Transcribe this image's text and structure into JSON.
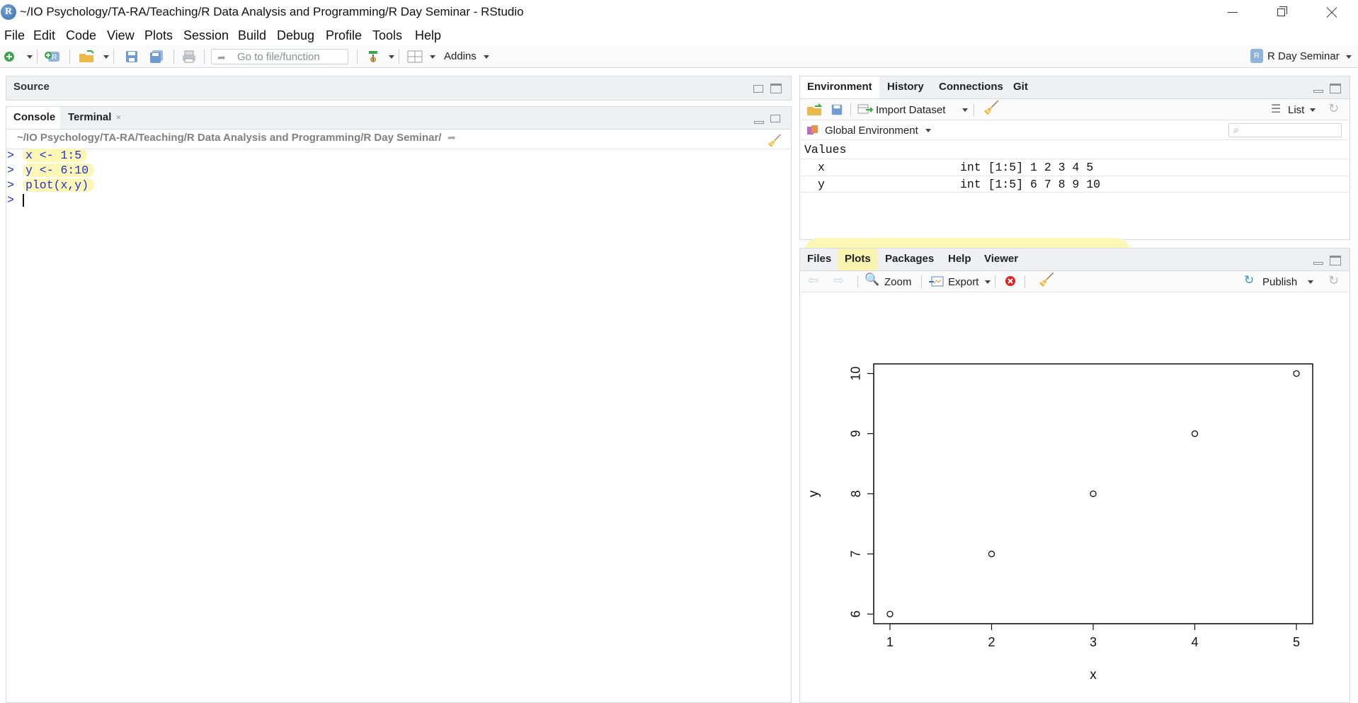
{
  "window": {
    "title": "~/IO Psychology/TA-RA/Teaching/R Data Analysis and Programming/R Day Seminar - RStudio",
    "logo_letter": "R"
  },
  "menu": [
    "File",
    "Edit",
    "Code",
    "View",
    "Plots",
    "Session",
    "Build",
    "Debug",
    "Profile",
    "Tools",
    "Help"
  ],
  "toolbar": {
    "goto_placeholder": "Go to file/function",
    "addins_label": "Addins",
    "project_label": "R Day Seminar"
  },
  "source": {
    "title": "Source"
  },
  "console": {
    "tabs": [
      "Console",
      "Terminal"
    ],
    "path": "~/IO Psychology/TA-RA/Teaching/R Data Analysis and Programming/R Day Seminar/",
    "prompt": ">",
    "lines": [
      "x <- 1:5",
      "y <- 6:10",
      "plot(x,y)"
    ]
  },
  "environment": {
    "tabs": [
      "Environment",
      "History",
      "Connections",
      "Git"
    ],
    "import_label": "Import Dataset",
    "view_mode": "List",
    "scope": "Global Environment",
    "section": "Values",
    "rows": [
      {
        "name": "x",
        "value": "int [1:5] 1 2 3 4 5"
      },
      {
        "name": "y",
        "value": "int [1:5] 6 7 8 9 10"
      }
    ]
  },
  "plots_pane": {
    "tabs": [
      "Files",
      "Plots",
      "Packages",
      "Help",
      "Viewer"
    ],
    "zoom_label": "Zoom",
    "export_label": "Export",
    "publish_label": "Publish"
  },
  "chart_data": {
    "type": "scatter",
    "x": [
      1,
      2,
      3,
      4,
      5
    ],
    "y": [
      6,
      7,
      8,
      9,
      10
    ],
    "xlabel": "x",
    "ylabel": "y",
    "xlim": [
      0.84,
      5.16
    ],
    "ylim": [
      5.84,
      10.16
    ],
    "x_ticks": [
      "1",
      "2",
      "3",
      "4",
      "5"
    ],
    "y_ticks": [
      "6",
      "7",
      "8",
      "9",
      "10"
    ],
    "marker": "open-circle",
    "grid": false
  }
}
